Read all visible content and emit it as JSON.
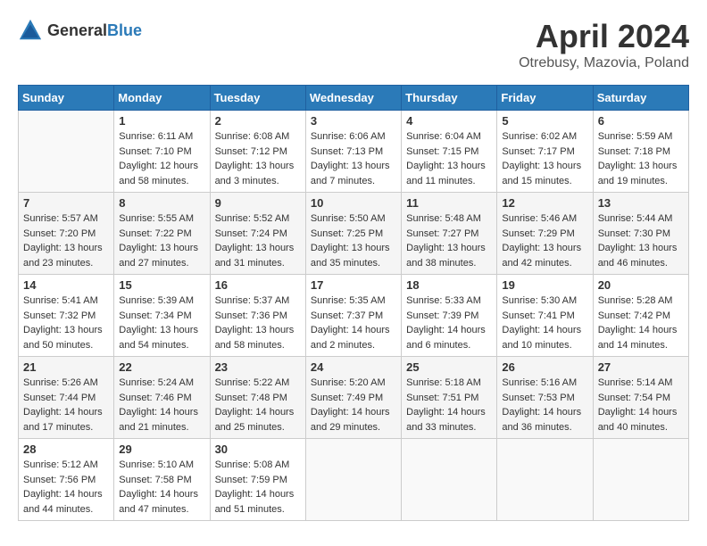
{
  "header": {
    "logo_general": "General",
    "logo_blue": "Blue",
    "title": "April 2024",
    "location": "Otrebusy, Mazovia, Poland"
  },
  "weekdays": [
    "Sunday",
    "Monday",
    "Tuesday",
    "Wednesday",
    "Thursday",
    "Friday",
    "Saturday"
  ],
  "weeks": [
    [
      {
        "day": "",
        "sunrise": "",
        "sunset": "",
        "daylight": ""
      },
      {
        "day": "1",
        "sunrise": "Sunrise: 6:11 AM",
        "sunset": "Sunset: 7:10 PM",
        "daylight": "Daylight: 12 hours and 58 minutes."
      },
      {
        "day": "2",
        "sunrise": "Sunrise: 6:08 AM",
        "sunset": "Sunset: 7:12 PM",
        "daylight": "Daylight: 13 hours and 3 minutes."
      },
      {
        "day": "3",
        "sunrise": "Sunrise: 6:06 AM",
        "sunset": "Sunset: 7:13 PM",
        "daylight": "Daylight: 13 hours and 7 minutes."
      },
      {
        "day": "4",
        "sunrise": "Sunrise: 6:04 AM",
        "sunset": "Sunset: 7:15 PM",
        "daylight": "Daylight: 13 hours and 11 minutes."
      },
      {
        "day": "5",
        "sunrise": "Sunrise: 6:02 AM",
        "sunset": "Sunset: 7:17 PM",
        "daylight": "Daylight: 13 hours and 15 minutes."
      },
      {
        "day": "6",
        "sunrise": "Sunrise: 5:59 AM",
        "sunset": "Sunset: 7:18 PM",
        "daylight": "Daylight: 13 hours and 19 minutes."
      }
    ],
    [
      {
        "day": "7",
        "sunrise": "Sunrise: 5:57 AM",
        "sunset": "Sunset: 7:20 PM",
        "daylight": "Daylight: 13 hours and 23 minutes."
      },
      {
        "day": "8",
        "sunrise": "Sunrise: 5:55 AM",
        "sunset": "Sunset: 7:22 PM",
        "daylight": "Daylight: 13 hours and 27 minutes."
      },
      {
        "day": "9",
        "sunrise": "Sunrise: 5:52 AM",
        "sunset": "Sunset: 7:24 PM",
        "daylight": "Daylight: 13 hours and 31 minutes."
      },
      {
        "day": "10",
        "sunrise": "Sunrise: 5:50 AM",
        "sunset": "Sunset: 7:25 PM",
        "daylight": "Daylight: 13 hours and 35 minutes."
      },
      {
        "day": "11",
        "sunrise": "Sunrise: 5:48 AM",
        "sunset": "Sunset: 7:27 PM",
        "daylight": "Daylight: 13 hours and 38 minutes."
      },
      {
        "day": "12",
        "sunrise": "Sunrise: 5:46 AM",
        "sunset": "Sunset: 7:29 PM",
        "daylight": "Daylight: 13 hours and 42 minutes."
      },
      {
        "day": "13",
        "sunrise": "Sunrise: 5:44 AM",
        "sunset": "Sunset: 7:30 PM",
        "daylight": "Daylight: 13 hours and 46 minutes."
      }
    ],
    [
      {
        "day": "14",
        "sunrise": "Sunrise: 5:41 AM",
        "sunset": "Sunset: 7:32 PM",
        "daylight": "Daylight: 13 hours and 50 minutes."
      },
      {
        "day": "15",
        "sunrise": "Sunrise: 5:39 AM",
        "sunset": "Sunset: 7:34 PM",
        "daylight": "Daylight: 13 hours and 54 minutes."
      },
      {
        "day": "16",
        "sunrise": "Sunrise: 5:37 AM",
        "sunset": "Sunset: 7:36 PM",
        "daylight": "Daylight: 13 hours and 58 minutes."
      },
      {
        "day": "17",
        "sunrise": "Sunrise: 5:35 AM",
        "sunset": "Sunset: 7:37 PM",
        "daylight": "Daylight: 14 hours and 2 minutes."
      },
      {
        "day": "18",
        "sunrise": "Sunrise: 5:33 AM",
        "sunset": "Sunset: 7:39 PM",
        "daylight": "Daylight: 14 hours and 6 minutes."
      },
      {
        "day": "19",
        "sunrise": "Sunrise: 5:30 AM",
        "sunset": "Sunset: 7:41 PM",
        "daylight": "Daylight: 14 hours and 10 minutes."
      },
      {
        "day": "20",
        "sunrise": "Sunrise: 5:28 AM",
        "sunset": "Sunset: 7:42 PM",
        "daylight": "Daylight: 14 hours and 14 minutes."
      }
    ],
    [
      {
        "day": "21",
        "sunrise": "Sunrise: 5:26 AM",
        "sunset": "Sunset: 7:44 PM",
        "daylight": "Daylight: 14 hours and 17 minutes."
      },
      {
        "day": "22",
        "sunrise": "Sunrise: 5:24 AM",
        "sunset": "Sunset: 7:46 PM",
        "daylight": "Daylight: 14 hours and 21 minutes."
      },
      {
        "day": "23",
        "sunrise": "Sunrise: 5:22 AM",
        "sunset": "Sunset: 7:48 PM",
        "daylight": "Daylight: 14 hours and 25 minutes."
      },
      {
        "day": "24",
        "sunrise": "Sunrise: 5:20 AM",
        "sunset": "Sunset: 7:49 PM",
        "daylight": "Daylight: 14 hours and 29 minutes."
      },
      {
        "day": "25",
        "sunrise": "Sunrise: 5:18 AM",
        "sunset": "Sunset: 7:51 PM",
        "daylight": "Daylight: 14 hours and 33 minutes."
      },
      {
        "day": "26",
        "sunrise": "Sunrise: 5:16 AM",
        "sunset": "Sunset: 7:53 PM",
        "daylight": "Daylight: 14 hours and 36 minutes."
      },
      {
        "day": "27",
        "sunrise": "Sunrise: 5:14 AM",
        "sunset": "Sunset: 7:54 PM",
        "daylight": "Daylight: 14 hours and 40 minutes."
      }
    ],
    [
      {
        "day": "28",
        "sunrise": "Sunrise: 5:12 AM",
        "sunset": "Sunset: 7:56 PM",
        "daylight": "Daylight: 14 hours and 44 minutes."
      },
      {
        "day": "29",
        "sunrise": "Sunrise: 5:10 AM",
        "sunset": "Sunset: 7:58 PM",
        "daylight": "Daylight: 14 hours and 47 minutes."
      },
      {
        "day": "30",
        "sunrise": "Sunrise: 5:08 AM",
        "sunset": "Sunset: 7:59 PM",
        "daylight": "Daylight: 14 hours and 51 minutes."
      },
      {
        "day": "",
        "sunrise": "",
        "sunset": "",
        "daylight": ""
      },
      {
        "day": "",
        "sunrise": "",
        "sunset": "",
        "daylight": ""
      },
      {
        "day": "",
        "sunrise": "",
        "sunset": "",
        "daylight": ""
      },
      {
        "day": "",
        "sunrise": "",
        "sunset": "",
        "daylight": ""
      }
    ]
  ]
}
